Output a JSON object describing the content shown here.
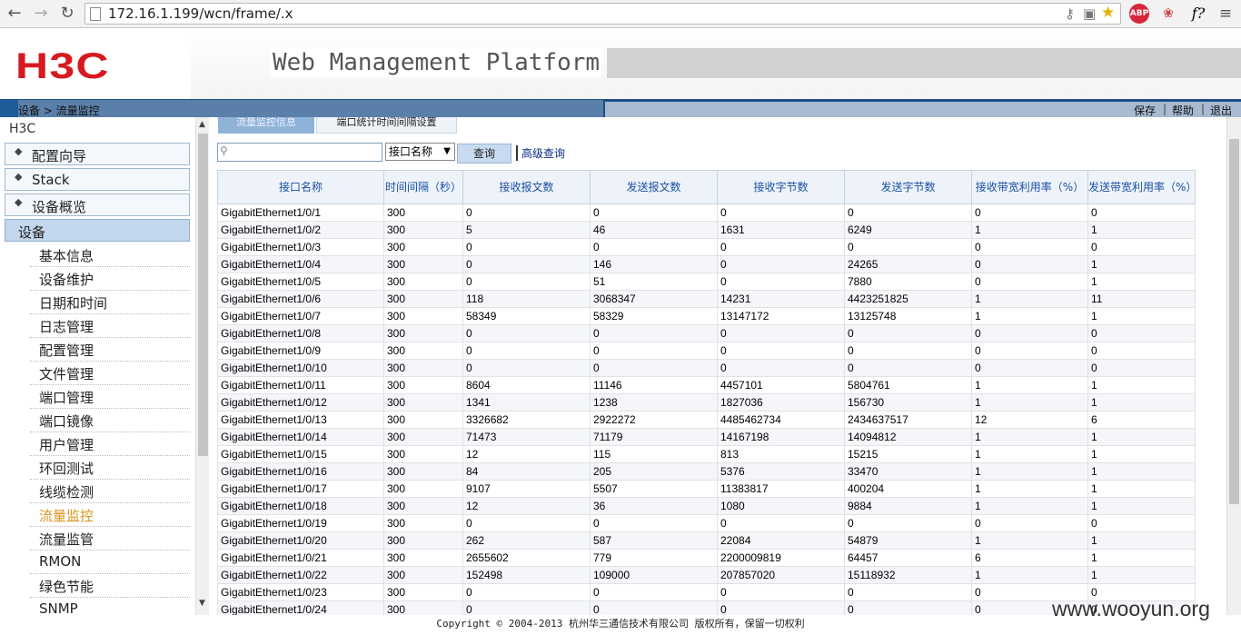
{
  "browser": {
    "url": "172.16.1.199/wcn/frame/.x",
    "ext_abp": "ABP",
    "ext_fx": "f?"
  },
  "header": {
    "logo": "H3C",
    "title": "Web Management Platform"
  },
  "breadcrumb": "设备 > 流量监控",
  "actions": {
    "save": "保存",
    "help": "帮助",
    "logout": "退出"
  },
  "sidebar": {
    "title": "H3C",
    "groups": [
      {
        "label": "配置向导"
      },
      {
        "label": "Stack"
      },
      {
        "label": "设备概览"
      },
      {
        "label": "设备"
      }
    ],
    "items": [
      {
        "label": "基本信息"
      },
      {
        "label": "设备维护"
      },
      {
        "label": "日期和时间"
      },
      {
        "label": "日志管理"
      },
      {
        "label": "配置管理"
      },
      {
        "label": "文件管理"
      },
      {
        "label": "端口管理"
      },
      {
        "label": "端口镜像"
      },
      {
        "label": "用户管理"
      },
      {
        "label": "环回测试"
      },
      {
        "label": "线缆检测"
      },
      {
        "label": "流量监控"
      },
      {
        "label": "流量监管"
      },
      {
        "label": "RMON"
      },
      {
        "label": "绿色节能"
      },
      {
        "label": "SNMP"
      }
    ],
    "active_item": "流量监控"
  },
  "tabs": [
    {
      "label": "流量监控信息"
    },
    {
      "label": "端口统计时间间隔设置"
    }
  ],
  "search": {
    "value": "",
    "field": "接口名称",
    "query_button": "查询",
    "advanced_link": "高级查询"
  },
  "table": {
    "columns": [
      "接口名称",
      "时间间隔（秒）",
      "接收报文数",
      "发送报文数",
      "接收字节数",
      "发送字节数",
      "接收带宽利用率（%）",
      "发送带宽利用率（%）"
    ],
    "rows": [
      [
        "GigabitEthernet1/0/1",
        "300",
        "0",
        "0",
        "0",
        "0",
        "0",
        "0"
      ],
      [
        "GigabitEthernet1/0/2",
        "300",
        "5",
        "46",
        "1631",
        "6249",
        "1",
        "1"
      ],
      [
        "GigabitEthernet1/0/3",
        "300",
        "0",
        "0",
        "0",
        "0",
        "0",
        "0"
      ],
      [
        "GigabitEthernet1/0/4",
        "300",
        "0",
        "146",
        "0",
        "24265",
        "0",
        "1"
      ],
      [
        "GigabitEthernet1/0/5",
        "300",
        "0",
        "51",
        "0",
        "7880",
        "0",
        "1"
      ],
      [
        "GigabitEthernet1/0/6",
        "300",
        "118",
        "3068347",
        "14231",
        "4423251825",
        "1",
        "11"
      ],
      [
        "GigabitEthernet1/0/7",
        "300",
        "58349",
        "58329",
        "13147172",
        "13125748",
        "1",
        "1"
      ],
      [
        "GigabitEthernet1/0/8",
        "300",
        "0",
        "0",
        "0",
        "0",
        "0",
        "0"
      ],
      [
        "GigabitEthernet1/0/9",
        "300",
        "0",
        "0",
        "0",
        "0",
        "0",
        "0"
      ],
      [
        "GigabitEthernet1/0/10",
        "300",
        "0",
        "0",
        "0",
        "0",
        "0",
        "0"
      ],
      [
        "GigabitEthernet1/0/11",
        "300",
        "8604",
        "11146",
        "4457101",
        "5804761",
        "1",
        "1"
      ],
      [
        "GigabitEthernet1/0/12",
        "300",
        "1341",
        "1238",
        "1827036",
        "156730",
        "1",
        "1"
      ],
      [
        "GigabitEthernet1/0/13",
        "300",
        "3326682",
        "2922272",
        "4485462734",
        "2434637517",
        "12",
        "6"
      ],
      [
        "GigabitEthernet1/0/14",
        "300",
        "71473",
        "71179",
        "14167198",
        "14094812",
        "1",
        "1"
      ],
      [
        "GigabitEthernet1/0/15",
        "300",
        "12",
        "115",
        "813",
        "15215",
        "1",
        "1"
      ],
      [
        "GigabitEthernet1/0/16",
        "300",
        "84",
        "205",
        "5376",
        "33470",
        "1",
        "1"
      ],
      [
        "GigabitEthernet1/0/17",
        "300",
        "9107",
        "5507",
        "11383817",
        "400204",
        "1",
        "1"
      ],
      [
        "GigabitEthernet1/0/18",
        "300",
        "12",
        "36",
        "1080",
        "9884",
        "1",
        "1"
      ],
      [
        "GigabitEthernet1/0/19",
        "300",
        "0",
        "0",
        "0",
        "0",
        "0",
        "0"
      ],
      [
        "GigabitEthernet1/0/20",
        "300",
        "262",
        "587",
        "22084",
        "54879",
        "1",
        "1"
      ],
      [
        "GigabitEthernet1/0/21",
        "300",
        "2655602",
        "779",
        "2200009819",
        "64457",
        "6",
        "1"
      ],
      [
        "GigabitEthernet1/0/22",
        "300",
        "152498",
        "109000",
        "207857020",
        "15118932",
        "1",
        "1"
      ],
      [
        "GigabitEthernet1/0/23",
        "300",
        "0",
        "0",
        "0",
        "0",
        "0",
        "0"
      ],
      [
        "GigabitEthernet1/0/24",
        "300",
        "0",
        "0",
        "0",
        "0",
        "0",
        "0"
      ]
    ]
  },
  "footer": "Copyright © 2004-2013 杭州华三通信技术有限公司 版权所有，保留一切权利",
  "watermark": "www.wooyun.org"
}
